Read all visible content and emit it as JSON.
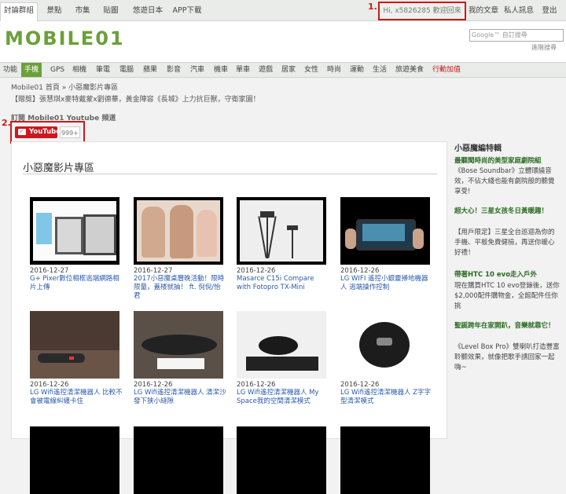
{
  "topbar": {
    "tabs": [
      "討論群組",
      "景點",
      "市集",
      "貼圖",
      "悠遊日本",
      "APP下載"
    ],
    "greeting": "Hi, x5826285 歡迎回來 ▼",
    "links": [
      "我的文章",
      "私人訊息",
      "登出"
    ]
  },
  "header": {
    "logo": "MOBILE01",
    "search_placeholder": "Google™ 自訂搜尋",
    "advanced_search": "進階搜尋"
  },
  "nav": {
    "items": [
      "功能",
      "手機",
      "GPS",
      "相機",
      "筆電",
      "電腦",
      "蘋果",
      "影音",
      "汽車",
      "機車",
      "單車",
      "遊戲",
      "居家",
      "女性",
      "時尚",
      "運動",
      "生活",
      "旅遊美食",
      "行動加值"
    ],
    "active": "手機"
  },
  "breadcrumb": "Mobile01 首頁 » 小惡魔影片專區",
  "promo": "【贈獎】張慧琪x麥特戴蒙x劉德華，黃金陣容《長城》上力抗巨獸，守衛家園！",
  "subscribe": {
    "label": "訂閱 Mobile01 Youtube 頻道",
    "button": "YouTube",
    "count": "999+"
  },
  "annotations": [
    "1.",
    "2."
  ],
  "main": {
    "title": "小惡魔影片專區",
    "videos": [
      {
        "date": "2016-12-27",
        "title": "G+ Pixer數位相框逃端網路相片上傳"
      },
      {
        "date": "2016-12-27",
        "title": "2017小惡魔桌曆晚活動！限時限量，蓋楼就抽！ ft. 倪倪/怡君"
      },
      {
        "date": "2016-12-26",
        "title": "Masarce C15i Compare with Fotopro TX-Mini"
      },
      {
        "date": "2016-12-26",
        "title": "LG WIFI 遙控小銀靈掃地機器人 逃端操作控制"
      },
      {
        "date": "2016-12-26",
        "title": "LG Wifi遙控清潔機器人 比較不會被電線糾纏卡住"
      },
      {
        "date": "2016-12-26",
        "title": "LG Wifi遙控清潔機器人 清潔沙發下狭小縫隙"
      },
      {
        "date": "2016-12-26",
        "title": "LG Wifi遙控清潔機器人 My Space我的空間清潔模式"
      },
      {
        "date": "2016-12-26",
        "title": "LG Wifi遙控清潔機器人 Z字字型清潔模式"
      }
    ]
  },
  "side": {
    "heading": "小惡魔編特輯",
    "items": [
      {
        "title": "最聽聞時尚的美型家庭劇院組",
        "body": "《Bose Soundbar》立體環繞音效，不佔大綫也能有劇院般的聽覺享受!"
      },
      {
        "title": "超大心！三星女孩冬日黃暖趣！",
        "body": "【用戶限定】三星全台巡迴為你的手機、平板免費健檢，再送你暖心好禮！"
      },
      {
        "title": "帶著HTC 10 evo走入戶外",
        "body": "現在購買HTC 10 evo登錄後，送你$2,000配件購物金，全館配件任你挑"
      },
      {
        "title": "聖誕跨年在家開趴，音樂就靠它！",
        "body": "《Level Box Pro》雙喇叭打造豐富聆聽效果，就像把歌手請回家一起嗨~"
      }
    ]
  }
}
